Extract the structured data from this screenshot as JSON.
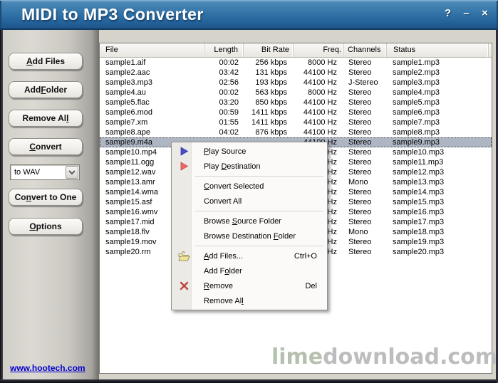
{
  "window": {
    "title": "MIDI to MP3 Converter",
    "controls": {
      "help": "?",
      "minimize": "–",
      "close": "×"
    }
  },
  "sidebar": {
    "buttons": [
      {
        "text": "Add Files",
        "accel": 0
      },
      {
        "text": "Add Folder",
        "accel": 4
      },
      {
        "text": "Remove All",
        "accel": 9
      },
      {
        "text": "Convert",
        "accel": 0
      },
      {
        "text": "Convert to One",
        "accel": 2
      },
      {
        "text": "Options",
        "accel": 0
      }
    ],
    "format_select": {
      "value": "to WAV"
    },
    "link": "www.hootech.com"
  },
  "table": {
    "columns": [
      "File",
      "Length",
      "Bit Rate",
      "Freq.",
      "Channels",
      "Status"
    ],
    "selected_index": 8,
    "rows": [
      {
        "file": "sample1.aif",
        "length": "00:02",
        "bit_rate": "256 kbps",
        "freq": "8000 Hz",
        "channels": "Stereo",
        "status": "sample1.mp3"
      },
      {
        "file": "sample2.aac",
        "length": "03:42",
        "bit_rate": "131 kbps",
        "freq": "44100 Hz",
        "channels": "Stereo",
        "status": "sample2.mp3"
      },
      {
        "file": "sample3.mp3",
        "length": "02:56",
        "bit_rate": "193 kbps",
        "freq": "44100 Hz",
        "channels": "J-Stereo",
        "status": "sample3.mp3"
      },
      {
        "file": "sample4.au",
        "length": "00:02",
        "bit_rate": "563 kbps",
        "freq": "8000 Hz",
        "channels": "Stereo",
        "status": "sample4.mp3"
      },
      {
        "file": "sample5.flac",
        "length": "03:20",
        "bit_rate": "850 kbps",
        "freq": "44100 Hz",
        "channels": "Stereo",
        "status": "sample5.mp3"
      },
      {
        "file": "sample6.mod",
        "length": "00:59",
        "bit_rate": "1411 kbps",
        "freq": "44100 Hz",
        "channels": "Stereo",
        "status": "sample6.mp3"
      },
      {
        "file": "sample7.xm",
        "length": "01:55",
        "bit_rate": "1411 kbps",
        "freq": "44100 Hz",
        "channels": "Stereo",
        "status": "sample7.mp3"
      },
      {
        "file": "sample8.ape",
        "length": "04:02",
        "bit_rate": "876 kbps",
        "freq": "44100 Hz",
        "channels": "Stereo",
        "status": "sample8.mp3"
      },
      {
        "file": "sample9.m4a",
        "length": "",
        "bit_rate": "",
        "freq": "44100 Hz",
        "channels": "Stereo",
        "status": "sample9.mp3"
      },
      {
        "file": "sample10.mp4",
        "length": "",
        "bit_rate": "",
        "freq": "44100 Hz",
        "channels": "Stereo",
        "status": "sample10.mp3"
      },
      {
        "file": "sample11.ogg",
        "length": "",
        "bit_rate": "",
        "freq": "44100 Hz",
        "channels": "Stereo",
        "status": "sample11.mp3"
      },
      {
        "file": "sample12.wav",
        "length": "",
        "bit_rate": "",
        "freq": "44100 Hz",
        "channels": "Stereo",
        "status": "sample12.mp3"
      },
      {
        "file": "sample13.amr",
        "length": "",
        "bit_rate": "",
        "freq": "44100 Hz",
        "channels": "Mono",
        "status": "sample13.mp3"
      },
      {
        "file": "sample14.wma",
        "length": "",
        "bit_rate": "",
        "freq": "44100 Hz",
        "channels": "Stereo",
        "status": "sample14.mp3"
      },
      {
        "file": "sample15.asf",
        "length": "",
        "bit_rate": "",
        "freq": "44100 Hz",
        "channels": "Stereo",
        "status": "sample15.mp3"
      },
      {
        "file": "sample16.wmv",
        "length": "",
        "bit_rate": "",
        "freq": "44100 Hz",
        "channels": "Stereo",
        "status": "sample16.mp3"
      },
      {
        "file": "sample17.mid",
        "length": "",
        "bit_rate": "",
        "freq": "44100 Hz",
        "channels": "Stereo",
        "status": "sample17.mp3"
      },
      {
        "file": "sample18.flv",
        "length": "",
        "bit_rate": "",
        "freq": "44100 Hz",
        "channels": "Mono",
        "status": "sample18.mp3"
      },
      {
        "file": "sample19.mov",
        "length": "",
        "bit_rate": "",
        "freq": "44100 Hz",
        "channels": "Stereo",
        "status": "sample19.mp3"
      },
      {
        "file": "sample20.rm",
        "length": "",
        "bit_rate": "",
        "freq": "44100 Hz",
        "channels": "Stereo",
        "status": "sample20.mp3"
      }
    ]
  },
  "menu": {
    "items": [
      {
        "type": "item",
        "label": "Play Source",
        "accel": 0,
        "icon": "play-source",
        "shortcut": ""
      },
      {
        "type": "item",
        "label": "Play Destination",
        "accel": 5,
        "icon": "play-destination",
        "shortcut": ""
      },
      {
        "type": "separator"
      },
      {
        "type": "item",
        "label": "Convert Selected",
        "accel": 0,
        "shortcut": ""
      },
      {
        "type": "item",
        "label": "Convert All",
        "accel": -1,
        "shortcut": ""
      },
      {
        "type": "separator"
      },
      {
        "type": "item",
        "label": "Browse Source Folder",
        "accel": 7,
        "shortcut": ""
      },
      {
        "type": "item",
        "label": "Browse Destination Folder",
        "accel": 19,
        "shortcut": ""
      },
      {
        "type": "separator"
      },
      {
        "type": "item",
        "label": "Add Files...",
        "accel": 0,
        "icon": "add-files",
        "shortcut": "Ctrl+O"
      },
      {
        "type": "item",
        "label": "Add Folder",
        "accel": 5,
        "shortcut": ""
      },
      {
        "type": "item",
        "label": "Remove",
        "accel": 0,
        "icon": "remove",
        "shortcut": "Del"
      },
      {
        "type": "item",
        "label": "Remove All",
        "accel": 9,
        "shortcut": ""
      }
    ]
  },
  "watermark": {
    "prefix": "lime",
    "suffix": "download.com"
  },
  "colors": {
    "titlebar_blue": "#3273a6",
    "selection": "#aeb6c3",
    "link_blue": "#0000cc",
    "watermark_gray": "#bdbdbd",
    "watermark_lime": "#b6c0ae"
  }
}
